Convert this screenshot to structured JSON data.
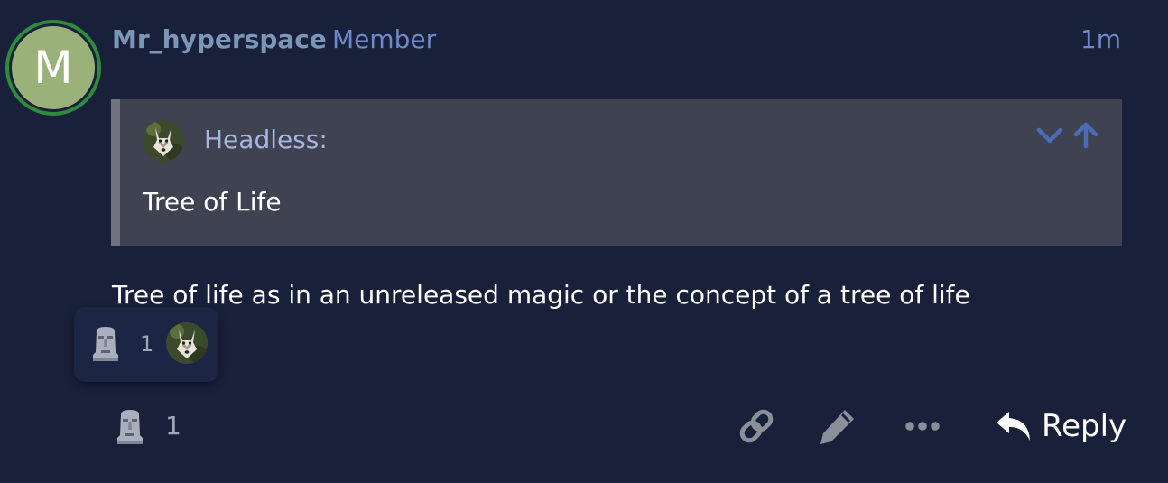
{
  "post": {
    "avatar_letter": "M",
    "avatar_color": "#9ab17a",
    "username": "Mr_hyperspace",
    "role": "Member",
    "time": "1m",
    "quote": {
      "author": "Headless:",
      "text": "Tree of Life",
      "controls": [
        "chevron-down-icon",
        "arrow-up-icon"
      ]
    },
    "body": "Tree of life as in an unreleased magic or the concept of a tree of life",
    "reactions_tooltip": {
      "emoji": "moai-icon",
      "count": "1"
    },
    "reaction": {
      "emoji": "moai-icon",
      "count": "1"
    },
    "actions": {
      "link_icon": "link-icon",
      "edit_icon": "pencil-icon",
      "more_icon": "ellipsis-icon",
      "reply_label": "Reply"
    }
  },
  "colors": {
    "background": "#19203a",
    "accent": "#6e88c8",
    "quote_bg": "#3f4250",
    "avatar_ring": "#2f8a3c"
  }
}
